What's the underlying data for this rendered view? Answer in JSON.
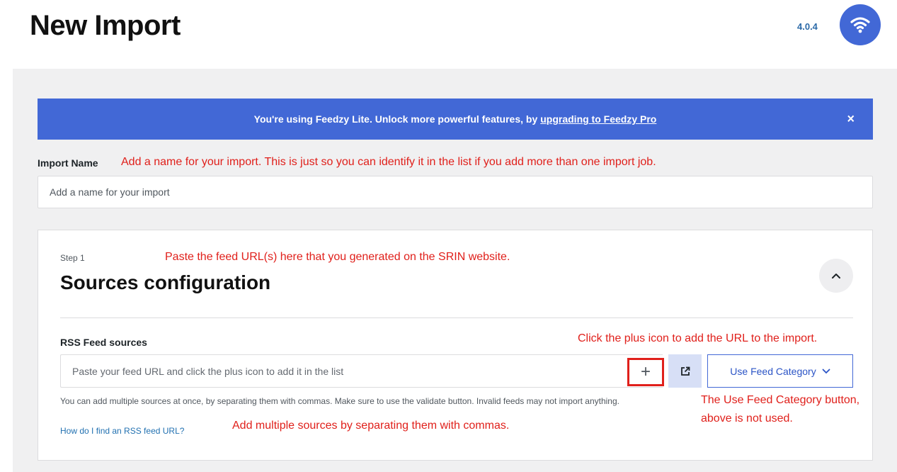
{
  "header": {
    "title": "New Import",
    "version": "4.0.4",
    "logo_icon": "wifi-icon",
    "logo_color": "#4268d6"
  },
  "banner": {
    "text": "You're using Feedzy Lite. Unlock more powerful features, by",
    "link_text": "upgrading to Feedzy Pro",
    "close_symbol": "×",
    "color": "#4268d6"
  },
  "import_name": {
    "label": "Import Name",
    "placeholder": "Add a name for your import"
  },
  "step": {
    "label": "Step 1",
    "title": "Sources configuration",
    "collapse_icon": "chevron-up-icon"
  },
  "rss": {
    "label": "RSS Feed sources",
    "placeholder": "Paste your feed URL and click the plus icon to add it in the list",
    "plus_symbol": "+",
    "open_icon": "external-link-icon",
    "category_button": "Use Feed Category",
    "help_text": "You can add multiple sources at once, by separating them with commas. Make sure to use the validate button. Invalid feeds may not import anything.",
    "help_link": "How do I find an RSS feed URL?"
  },
  "annotations": {
    "import_name_note": "Add a name for your import. This is just so you can identify it in the list if you add more than one import job.",
    "paste_note": "Paste the feed URL(s) here that you generated on the SRIN website.",
    "plus_note": "Click the plus icon to add the URL to the import.",
    "category_note_line1": "The Use Feed Category button,",
    "category_note_line2": "above is not used.",
    "multiple_note": "Add multiple sources by separating them with commas.",
    "color": "#e0201b"
  }
}
